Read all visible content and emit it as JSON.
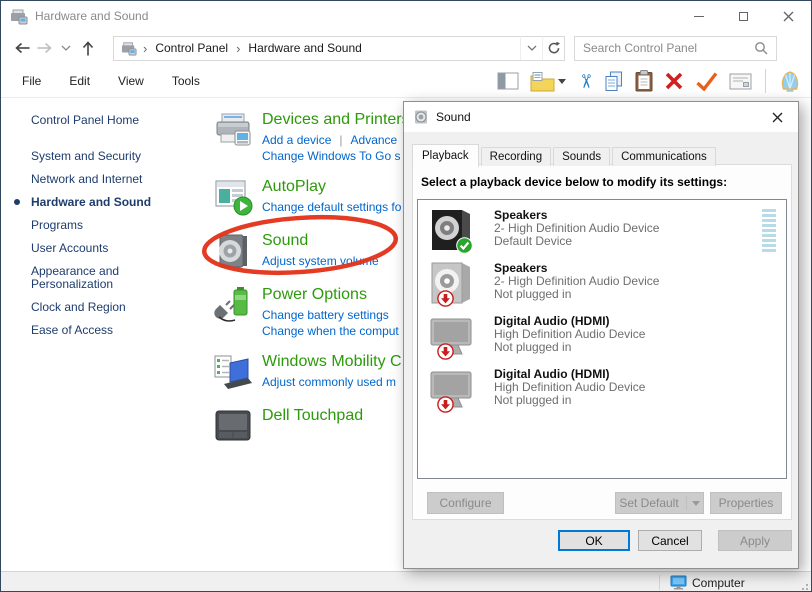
{
  "colors": {
    "accent_green": "#2c9a0b",
    "link_blue": "#0066cc",
    "sidebar_navy": "#1e3c6e",
    "annotation_red": "#e2331b",
    "focus_blue": "#0078d7",
    "window_border": "#33475f",
    "badge_green": "#2ba52b",
    "badge_red": "#c81e1e"
  },
  "window": {
    "title": "Hardware and Sound"
  },
  "navbar": {
    "breadcrumbs": [
      "Control Panel",
      "Hardware and Sound"
    ],
    "search_placeholder": "Search Control Panel"
  },
  "menubar": {
    "items": [
      "File",
      "Edit",
      "View",
      "Tools"
    ]
  },
  "toolbar": {
    "icons": [
      "views",
      "folder-options",
      "cut",
      "copy",
      "paste",
      "delete",
      "check",
      "properties",
      "shell"
    ]
  },
  "sidebar": {
    "home_label": "Control Panel Home",
    "items": [
      {
        "label": "System and Security",
        "active": false
      },
      {
        "label": "Network and Internet",
        "active": false
      },
      {
        "label": "Hardware and Sound",
        "active": true
      },
      {
        "label": "Programs",
        "active": false
      },
      {
        "label": "User Accounts",
        "active": false
      },
      {
        "label": "Appearance and Personalization",
        "active": false
      },
      {
        "label": "Clock and Region",
        "active": false
      },
      {
        "label": "Ease of Access",
        "active": false
      }
    ]
  },
  "content": {
    "items": [
      {
        "icon": "printer",
        "title": "Devices and Printers",
        "rows": [
          [
            "Add a device",
            "Advance"
          ],
          [
            "Change Windows To Go s"
          ]
        ]
      },
      {
        "icon": "autoplay",
        "title": "AutoPlay",
        "rows": [
          [
            "Change default settings fo"
          ]
        ]
      },
      {
        "icon": "speaker",
        "title": "Sound",
        "rows": [
          [
            "Adjust system volume"
          ]
        ]
      },
      {
        "icon": "power",
        "title": "Power Options",
        "rows": [
          [
            "Change battery settings"
          ],
          [
            "Change when the comput"
          ]
        ]
      },
      {
        "icon": "mobility",
        "title": "Windows Mobility C",
        "rows": [
          [
            "Adjust commonly used m"
          ]
        ]
      },
      {
        "icon": "touchpad",
        "title": "Dell Touchpad",
        "rows": []
      }
    ]
  },
  "dialog": {
    "title": "Sound",
    "tabs": [
      "Playback",
      "Recording",
      "Sounds",
      "Communications"
    ],
    "active_tab": "Playback",
    "instruction": "Select a playback device below to modify its settings:",
    "devices": [
      {
        "icon": "speaker-dark",
        "badge": "check",
        "name": "Speakers",
        "description": "2- High Definition Audio Device",
        "status": "Default Device",
        "meter": true
      },
      {
        "icon": "speaker-light",
        "badge": "down",
        "name": "Speakers",
        "description": "2- High Definition Audio Device",
        "status": "Not plugged in",
        "meter": false
      },
      {
        "icon": "hdmi",
        "badge": "down",
        "name": "Digital Audio (HDMI)",
        "description": "High Definition Audio Device",
        "status": "Not plugged in",
        "meter": false
      },
      {
        "icon": "hdmi",
        "badge": "down",
        "name": "Digital Audio (HDMI)",
        "description": "High Definition Audio Device",
        "status": "Not plugged in",
        "meter": false
      }
    ],
    "buttons": {
      "configure": "Configure",
      "set_default": "Set Default",
      "properties": "Properties",
      "ok": "OK",
      "cancel": "Cancel",
      "apply": "Apply"
    }
  },
  "statusbar": {
    "computer_label": "Computer"
  }
}
